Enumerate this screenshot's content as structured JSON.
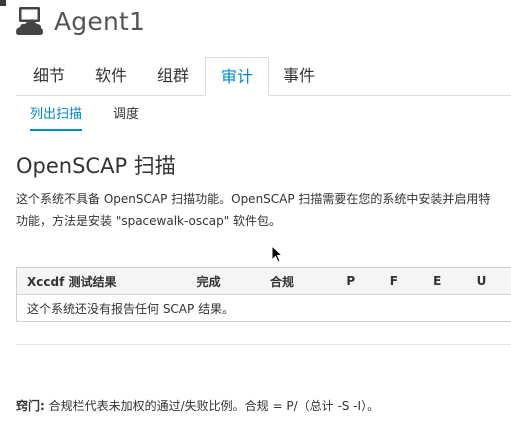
{
  "system": {
    "name": "Agent1",
    "icon": "server-icon"
  },
  "tabs": [
    {
      "label": "细节",
      "active": false
    },
    {
      "label": "软件",
      "active": false
    },
    {
      "label": "组群",
      "active": false
    },
    {
      "label": "审计",
      "active": true
    },
    {
      "label": "事件",
      "active": false
    }
  ],
  "subtabs": [
    {
      "label": "列出扫描",
      "active": true
    },
    {
      "label": "调度",
      "active": false
    }
  ],
  "page": {
    "title": "OpenSCAP 扫描",
    "description_line1": "这个系统不具备 OpenSCAP 扫描功能。OpenSCAP 扫描需要在您的系统中安装并启用特",
    "description_line2": "功能，方法是安装 \"spacewalk-oscap\" 软件包。"
  },
  "table": {
    "headers": [
      "Xccdf 测试结果",
      "完成",
      "合规",
      "P",
      "F",
      "E",
      "U"
    ],
    "empty_message": "这个系统还没有报告任何 SCAP 结果。"
  },
  "tip": {
    "label": "窍门:",
    "text": " 合规栏代表未加权的通过/失败比例。合规 = P/（总计 -S -I）。"
  },
  "colors": {
    "accent": "#0088ce",
    "text": "#333333",
    "border": "#d1d1d1"
  }
}
